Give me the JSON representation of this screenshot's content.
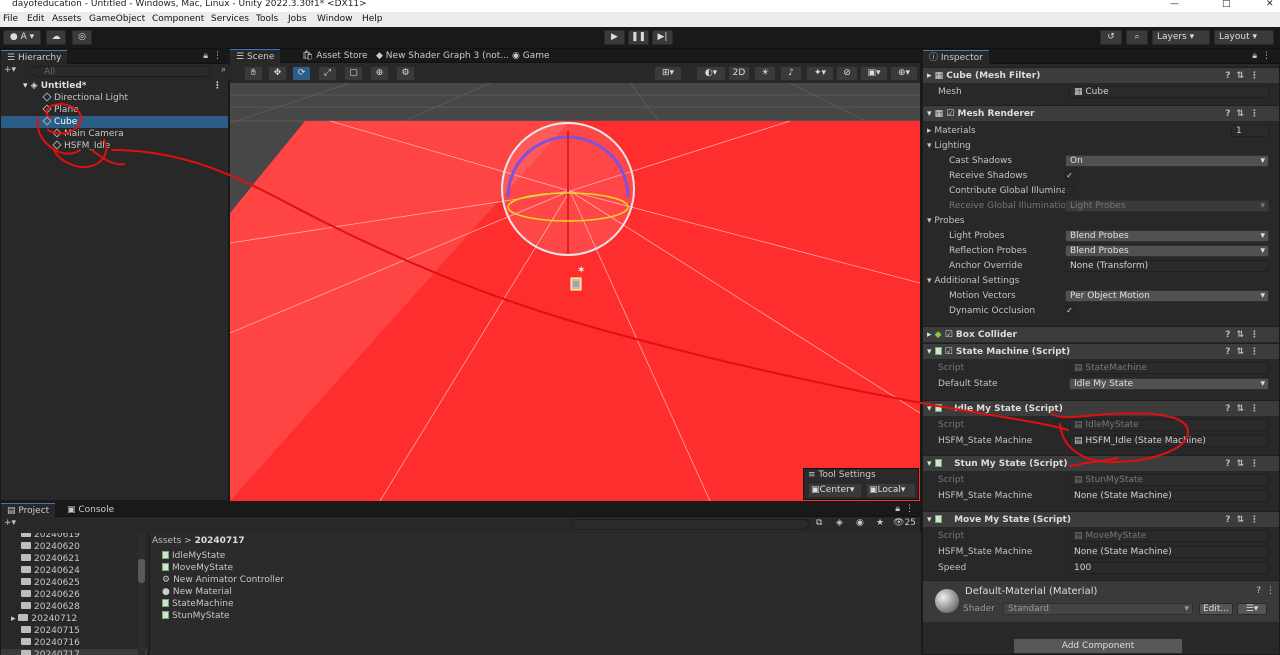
{
  "window": {
    "title": "dayofeducation - Untitled - Windows, Mac, Linux - Unity 2022.3.30f1* <DX11>",
    "min": "—",
    "max": "□",
    "close": "✕"
  },
  "menu": [
    "File",
    "Edit",
    "Assets",
    "GameObject",
    "Component",
    "Services",
    "Tools",
    "Jobs",
    "Window",
    "Help"
  ],
  "toolbar": {
    "account": "A",
    "layers": "Layers",
    "layout": "Layout"
  },
  "hierarchy": {
    "tab": "Hierarchy",
    "search_placeholder": "All",
    "scene": "Untitled*",
    "items": [
      "Directional Light",
      "Plane",
      "Cube",
      "Main Camera",
      "HSFM_Idle"
    ],
    "selected": "Cube"
  },
  "scene_tabs": [
    "Scene",
    "Asset Store",
    "New Shader Graph 3 (not...",
    "Game"
  ],
  "scene_view": {
    "mode_2d": "2D",
    "tool_settings": "Tool Settings",
    "pivot": "Center",
    "space": "Local",
    "floor_color": "#ff2a2a"
  },
  "inspector": {
    "tab": "Inspector",
    "mesh_filter": {
      "title": "Cube (Mesh Filter)",
      "mesh_label": "Mesh",
      "mesh_value": "Cube"
    },
    "mesh_renderer": {
      "title": "Mesh Renderer",
      "materials": "Materials",
      "materials_count": "1",
      "lighting": "Lighting",
      "cast_shadows": "Cast Shadows",
      "cast_shadows_value": "On",
      "receive_shadows": "Receive Shadows",
      "contribute_gi": "Contribute Global Illumina",
      "receive_gi": "Receive Global Illuminatio",
      "receive_gi_value": "Light Probes",
      "probes": "Probes",
      "light_probes": "Light Probes",
      "light_probes_value": "Blend Probes",
      "reflection_probes": "Reflection Probes",
      "reflection_probes_value": "Blend Probes",
      "anchor_override": "Anchor Override",
      "anchor_override_value": "None (Transform)",
      "additional": "Additional Settings",
      "motion_vectors": "Motion Vectors",
      "motion_vectors_value": "Per Object Motion",
      "dynamic_occlusion": "Dynamic Occlusion"
    },
    "box_collider": {
      "title": "Box Collider"
    },
    "state_machine": {
      "title": "State Machine (Script)",
      "script_label": "Script",
      "script_value": "StateMachine",
      "default_label": "Default State",
      "default_value": "Idle My State"
    },
    "idle": {
      "title": "Idle My State (Script)",
      "script_label": "Script",
      "script_value": "IdleMyState",
      "sm_label": "HSFM_State Machine",
      "sm_value": "HSFM_Idle (State Machine)"
    },
    "stun": {
      "title": "Stun My State (Script)",
      "script_label": "Script",
      "script_value": "StunMyState",
      "sm_label": "HSFM_State Machine",
      "sm_value": "None (State Machine)"
    },
    "move": {
      "title": "Move My State (Script)",
      "script_label": "Script",
      "script_value": "MoveMyState",
      "sm_label": "HSFM_State Machine",
      "sm_value": "None (State Machine)",
      "speed_label": "Speed",
      "speed_value": "100"
    },
    "material": {
      "title": "Default-Material (Material)",
      "shader_label": "Shader",
      "shader_value": "Standard",
      "edit": "Edit..."
    },
    "add_component": "Add Component"
  },
  "project": {
    "tab_project": "Project",
    "tab_console": "Console",
    "folders": [
      "20240619",
      "20240620",
      "20240621",
      "20240624",
      "20240625",
      "20240626",
      "20240628",
      "20240712",
      "20240715",
      "20240716",
      "20240717"
    ],
    "breadcrumb_root": "Assets",
    "breadcrumb_sep": ">",
    "breadcrumb_current": "20240717",
    "assets": [
      "IdleMyState",
      "MoveMyState",
      "New Animator Controller",
      "New Material",
      "StateMachine",
      "StunMyState"
    ],
    "hidden_count": "25"
  },
  "colors": {
    "annotation": "#e01010",
    "selection": "#2c5d87"
  }
}
